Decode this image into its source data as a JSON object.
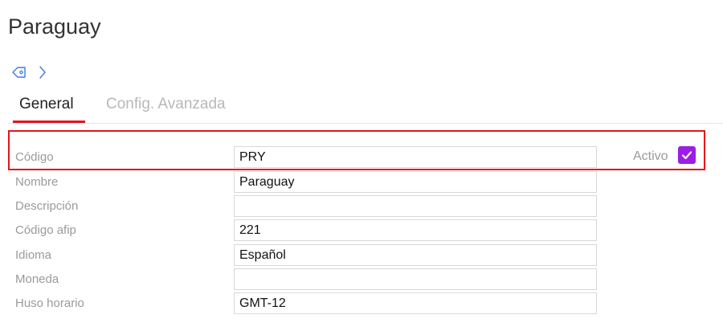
{
  "page": {
    "title": "Paraguay"
  },
  "breadcrumb": {
    "icon": "tag-icon",
    "separator_icon": "chevron-right-icon",
    "accent_color": "#3b7ddd"
  },
  "tabs": [
    {
      "label": "General",
      "active": true
    },
    {
      "label": "Config. Avanzada",
      "active": false
    }
  ],
  "form": {
    "fields": [
      {
        "label": "Código",
        "value": "PRY"
      },
      {
        "label": "Nombre",
        "value": "Paraguay"
      },
      {
        "label": "Descripción",
        "value": ""
      },
      {
        "label": "Código afip",
        "value": "221"
      },
      {
        "label": "Idioma",
        "value": "Español"
      },
      {
        "label": "Moneda",
        "value": ""
      },
      {
        "label": "Huso horario",
        "value": "GMT-12"
      }
    ],
    "activo": {
      "label": "Activo",
      "checked": true,
      "color": "#9b1de6"
    }
  },
  "colors": {
    "tab_underline": "#e3141c",
    "highlight_border": "#e3141c"
  }
}
